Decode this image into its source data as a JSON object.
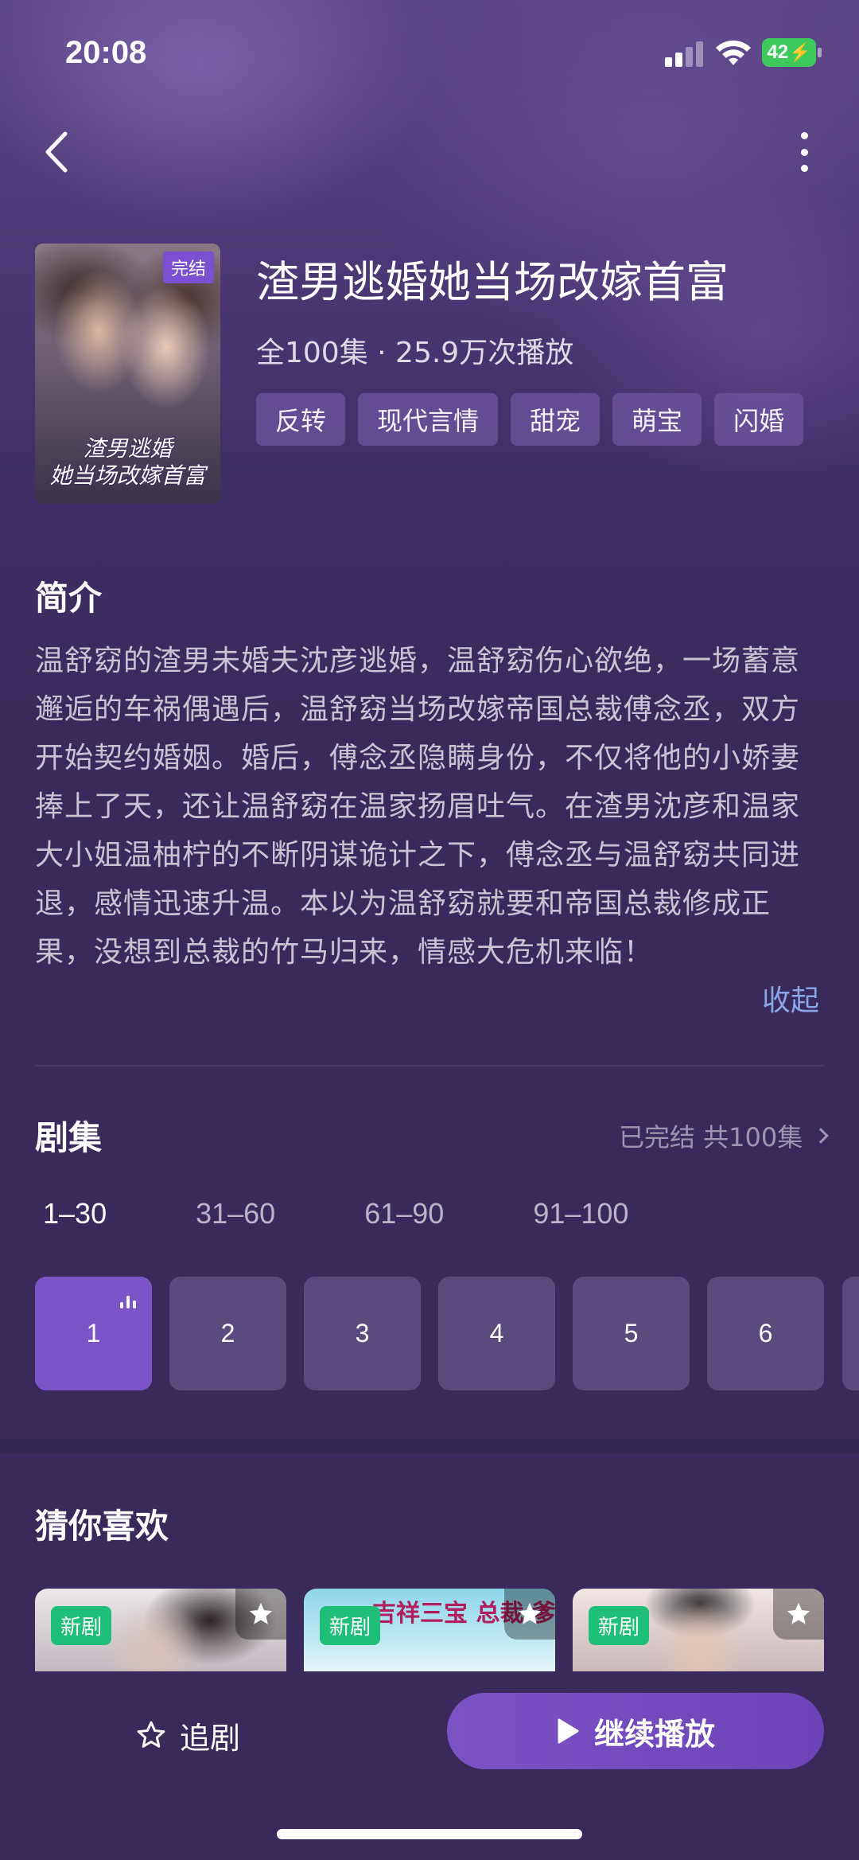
{
  "status_bar": {
    "time": "20:08",
    "battery": "42",
    "battery_color": "#3ec95c"
  },
  "nav": {
    "back_icon": "chevron-left-icon",
    "more_icon": "more-vertical-icon"
  },
  "show": {
    "poster_badge": "完结",
    "poster_title_line1": "渣男逃婚",
    "poster_title_line2": "她当场改嫁首富",
    "title": "渣男逃婚她当场改嫁首富",
    "meta": "全100集 · 25.9万次播放",
    "tags": [
      "反转",
      "现代言情",
      "甜宠",
      "萌宝",
      "闪婚"
    ]
  },
  "synopsis": {
    "title": "简介",
    "text": "温舒窈的渣男未婚夫沈彦逃婚，温舒窈伤心欲绝，一场蓄意邂逅的车祸偶遇后，温舒窈当场改嫁帝国总裁傅念丞，双方开始契约婚姻。婚后，傅念丞隐瞒身份，不仅将他的小娇妻捧上了天，还让温舒窈在温家扬眉吐气。在渣男沈彦和温家大小姐温柚柠的不断阴谋诡计之下，傅念丞与温舒窈共同进退，感情迅速升温。本以为温舒窈就要和帝国总裁修成正果，没想到总裁的竹马归来，情感大危机来临！",
    "collapse_label": "收起",
    "link_color": "#8aa6e6"
  },
  "episodes": {
    "title": "剧集",
    "status": "已完结 共100集",
    "ranges": [
      "1–30",
      "31–60",
      "61–90",
      "91–100"
    ],
    "active_range": 0,
    "items": [
      "1",
      "2",
      "3",
      "4",
      "5",
      "6"
    ],
    "active_episode": "1",
    "accent": "#7b55c8"
  },
  "recommend": {
    "title": "猜你喜欢",
    "items": [
      {
        "badge": "新剧",
        "text": ""
      },
      {
        "badge": "新剧",
        "text": "吉祥三宝 总裁 爹地超宠妻"
      },
      {
        "badge": "新剧",
        "text": ""
      }
    ],
    "badge_color": "#1fbf7a"
  },
  "bottom_bar": {
    "follow_label": "追剧",
    "follow_icon": "star-outline-icon",
    "play_label": "继续播放",
    "play_icon": "play-icon"
  }
}
